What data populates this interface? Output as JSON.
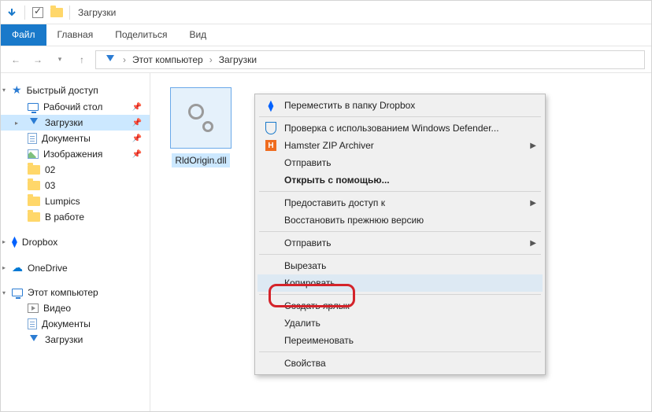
{
  "titlebar": {
    "title": "Загрузки"
  },
  "ribbon": {
    "file": "Файл",
    "home": "Главная",
    "share": "Поделиться",
    "view": "Вид"
  },
  "breadcrumb": {
    "root": "Этот компьютер",
    "sub": "Загрузки"
  },
  "sidebar": {
    "quick": "Быстрый доступ",
    "desktop": "Рабочий стол",
    "downloads": "Загрузки",
    "documents": "Документы",
    "pictures": "Изображения",
    "f02": "02",
    "f03": "03",
    "lumpics": "Lumpics",
    "inwork": "В работе",
    "dropbox": "Dropbox",
    "onedrive": "OneDrive",
    "thispc": "Этот компьютер",
    "video": "Видео",
    "documents2": "Документы",
    "downloads2": "Загрузки"
  },
  "file": {
    "name": "RldOrigin.dll"
  },
  "contextmenu": {
    "dropbox_move": "Переместить в папку Dropbox",
    "defender": "Проверка с использованием Windows Defender...",
    "hamster": "Hamster ZIP Archiver",
    "send1": "Отправить",
    "openwith": "Открыть с помощью...",
    "grant_access": "Предоставить доступ к",
    "restore_prev": "Восстановить прежнюю версию",
    "send2": "Отправить",
    "cut": "Вырезать",
    "copy": "Копировать",
    "shortcut": "Создать ярлык",
    "delete": "Удалить",
    "rename": "Переименовать",
    "properties": "Свойства"
  }
}
